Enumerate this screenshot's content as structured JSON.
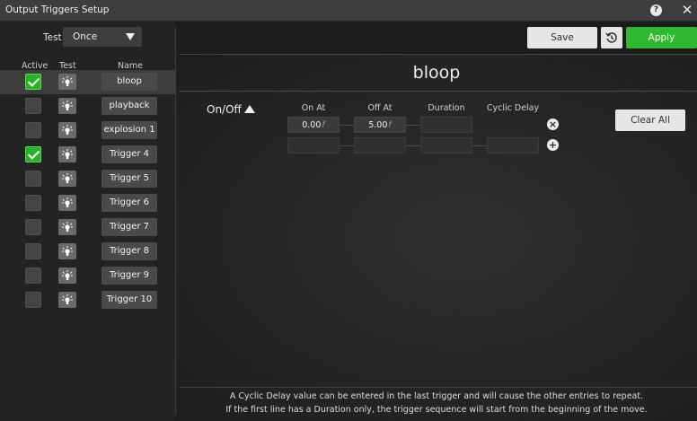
{
  "window": {
    "title": "Output Triggers Setup",
    "help_icon": "question-icon",
    "close_icon": "close-icon"
  },
  "left": {
    "test_label": "Test",
    "test_mode": "Once",
    "columns": {
      "active": "Active",
      "test": "Test",
      "name": "Name"
    },
    "triggers": [
      {
        "name": "bloop",
        "active": true
      },
      {
        "name": "playback",
        "active": false
      },
      {
        "name": "explosion 1",
        "active": false
      },
      {
        "name": "Trigger 4",
        "active": true
      },
      {
        "name": "Trigger 5",
        "active": false
      },
      {
        "name": "Trigger 6",
        "active": false
      },
      {
        "name": "Trigger 7",
        "active": false
      },
      {
        "name": "Trigger 8",
        "active": false
      },
      {
        "name": "Trigger 9",
        "active": false
      },
      {
        "name": "Trigger 10",
        "active": false
      }
    ]
  },
  "toolbar": {
    "save_label": "Save",
    "history_icon": "history-icon",
    "apply_label": "Apply"
  },
  "main": {
    "title": "bloop",
    "mode_label": "On/Off",
    "columns": {
      "on_at": "On At",
      "off_at": "Off At",
      "duration": "Duration",
      "cyclic_delay": "Cyclic Delay"
    },
    "rows": [
      {
        "on_at": "0.00",
        "on_unit": "f",
        "off_at": "5.00",
        "off_unit": "f",
        "duration": "",
        "cyclic_delay": ""
      },
      {
        "on_at": "",
        "on_unit": "",
        "off_at": "",
        "off_unit": "",
        "duration": "",
        "cyclic_delay": ""
      }
    ],
    "clear_all_label": "Clear All",
    "note_line1": "A Cyclic Delay value can be entered in the last trigger and will cause the other entries to repeat.",
    "note_line2": "If the first line has a Duration only, the trigger sequence will start from the beginning of the move."
  },
  "colors": {
    "accent": "#2fb92f",
    "checked": "#26b424",
    "background": "#1c1c1c"
  }
}
